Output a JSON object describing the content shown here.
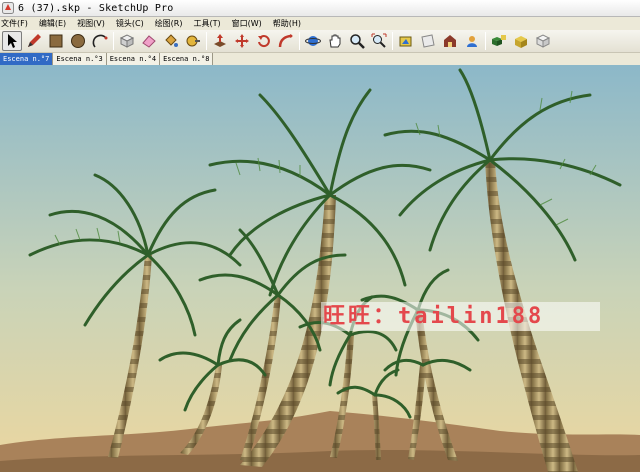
{
  "window": {
    "title": "6 (37).skp - SketchUp Pro"
  },
  "menu": [
    {
      "label": "文件(F)"
    },
    {
      "label": "编辑(E)"
    },
    {
      "label": "视图(V)"
    },
    {
      "label": "镜头(C)"
    },
    {
      "label": "绘图(R)"
    },
    {
      "label": "工具(T)"
    },
    {
      "label": "窗口(W)"
    },
    {
      "label": "帮助(H)"
    }
  ],
  "toolbar": {
    "tools": [
      "select-icon",
      "pencil-icon",
      "rectangle-icon",
      "circle-icon",
      "arc-icon",
      "make-component-icon",
      "eraser-icon",
      "paint-bucket-icon",
      "tape-measure-icon",
      "push-pull-icon",
      "move-icon",
      "rotate-icon",
      "follow-me-icon",
      "orbit-icon",
      "pan-icon",
      "zoom-icon",
      "zoom-extents-icon",
      "texture-icon",
      "section-plane-icon",
      "warehouse-icon",
      "extension-icon",
      "components-icon",
      "materials-icon",
      "layout-icon"
    ],
    "active_tool": "select-icon"
  },
  "scenes": [
    {
      "label": "Escena n.°7",
      "active": true
    },
    {
      "label": "Escena n.°3",
      "active": false
    },
    {
      "label": "Escena n.°4",
      "active": false
    },
    {
      "label": "Escena n.°8",
      "active": false
    }
  ],
  "watermark": {
    "text": "旺旺：tailin188"
  },
  "colors": {
    "sky_top": "#8fb9c9",
    "sky_bottom": "#e9d8a8",
    "sand": "#a9825a",
    "frond": "#2f5f2a",
    "trunk_light": "#b9a46e",
    "trunk_dark": "#6d5a36",
    "watermark": "#e4484c",
    "selected_tab": "#316ac5"
  }
}
